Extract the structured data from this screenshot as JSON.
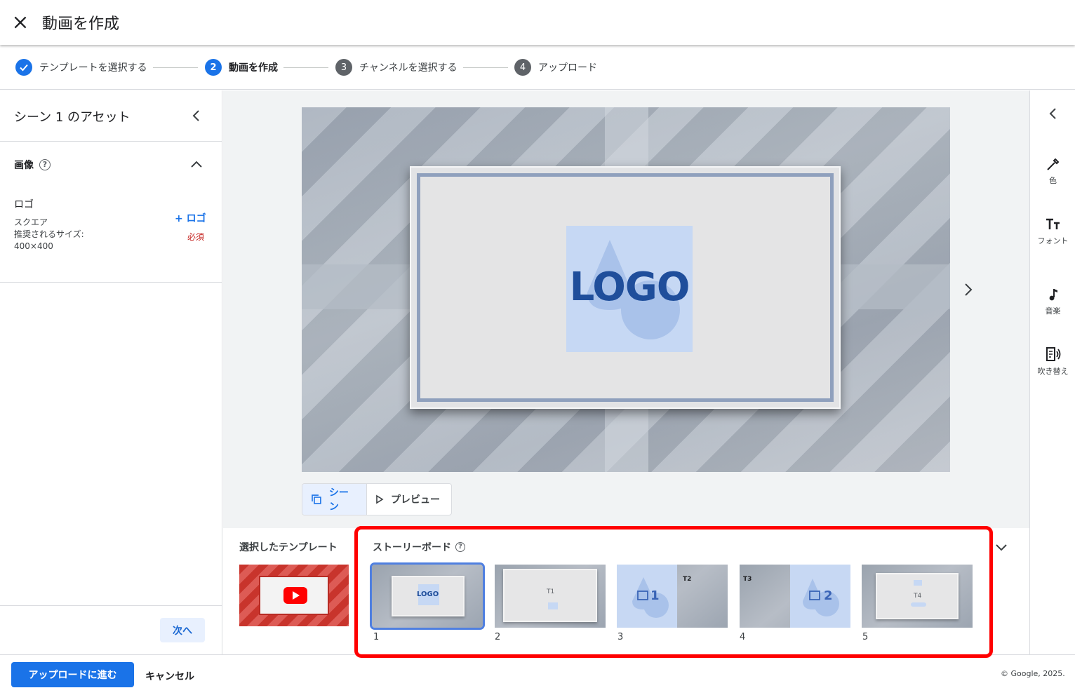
{
  "header": {
    "title": "動画を作成"
  },
  "stepper": {
    "steps": [
      {
        "label": "テンプレートを選択する",
        "status": "done"
      },
      {
        "number": "2",
        "label": "動画を作成",
        "status": "active"
      },
      {
        "number": "3",
        "label": "チャンネルを選択する",
        "status": "pending"
      },
      {
        "number": "4",
        "label": "アップロード",
        "status": "pending"
      }
    ]
  },
  "left_panel": {
    "title": "シーン 1 のアセット",
    "section_title": "画像",
    "logo": {
      "label": "ロゴ",
      "shape": "スクエア",
      "recommended_label": "推奨されるサイズ:",
      "recommended_size": "400×400",
      "add_label": "+ ロゴ",
      "required": "必須"
    },
    "next_label": "次へ"
  },
  "preview": {
    "logo_text": "LOGO"
  },
  "view_toggle": {
    "scene_label": "シーン",
    "preview_label": "プレビュー"
  },
  "bottom": {
    "template_label": "選択したテンプレート",
    "storyboard_label": "ストーリーボード",
    "scenes": [
      {
        "number": "1",
        "text": "LOGO"
      },
      {
        "number": "2",
        "text": "T1"
      },
      {
        "number": "3",
        "text": "T2",
        "big": "1"
      },
      {
        "number": "4",
        "text": "T3",
        "big": "2"
      },
      {
        "number": "5",
        "text": "T4"
      }
    ]
  },
  "right_rail": {
    "items": [
      {
        "icon": "color-picker-icon",
        "label": "色"
      },
      {
        "icon": "font-icon",
        "label": "フォント"
      },
      {
        "icon": "music-note-icon",
        "label": "音楽"
      },
      {
        "icon": "voiceover-icon",
        "label": "吹き替え"
      }
    ]
  },
  "footer": {
    "upload_label": "アップロードに進む",
    "cancel_label": "キャンセル",
    "copyright": "© Google, 2025."
  },
  "colors": {
    "primary": "#1a73e8",
    "highlight": "#ff0000",
    "required": "#c5221f"
  }
}
